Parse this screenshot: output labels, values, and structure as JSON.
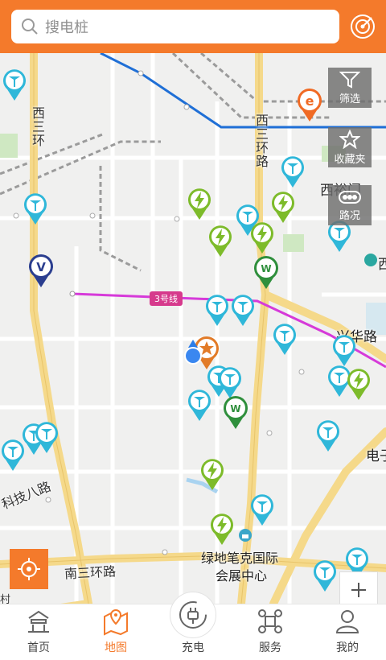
{
  "search": {
    "placeholder": "搜电桩"
  },
  "tools": [
    {
      "id": "filter",
      "label": "筛选",
      "icon": "filter-icon"
    },
    {
      "id": "favorites",
      "label": "收藏夹",
      "icon": "star-icon"
    },
    {
      "id": "traffic",
      "label": "路况",
      "icon": "traffic-icon"
    }
  ],
  "map": {
    "road_labels": {
      "west_third_ring_a": "西三环",
      "west_third_ring_b": "西三环路",
      "xiqiaomen": "西裕门",
      "xingua_road": "兴华路",
      "keji_8_road": "科技八路",
      "south_third_ring": "南三环路",
      "dianzi": "电子",
      "xi_edge": "西",
      "cun": "村",
      "metro_line": "3号线",
      "exhibition_1": "绿地笔克国际",
      "exhibition_2": "会展中心"
    }
  },
  "nav": [
    {
      "label": "首页",
      "icon": "home-icon"
    },
    {
      "label": "地图",
      "icon": "map-icon"
    },
    {
      "label": "充电",
      "icon": "charge-plug-icon"
    },
    {
      "label": "服务",
      "icon": "service-icon"
    },
    {
      "label": "我的",
      "icon": "profile-icon"
    }
  ],
  "colors": {
    "brand": "#f47a2b",
    "metro_line_3": "#d63ad9",
    "metro_blue": "#1f6fd6",
    "ring_road": "#f5d98a",
    "station_cyan": "#2fb7d9",
    "station_green": "#7dbb2a",
    "station_darkgreen": "#2f8f3c"
  }
}
